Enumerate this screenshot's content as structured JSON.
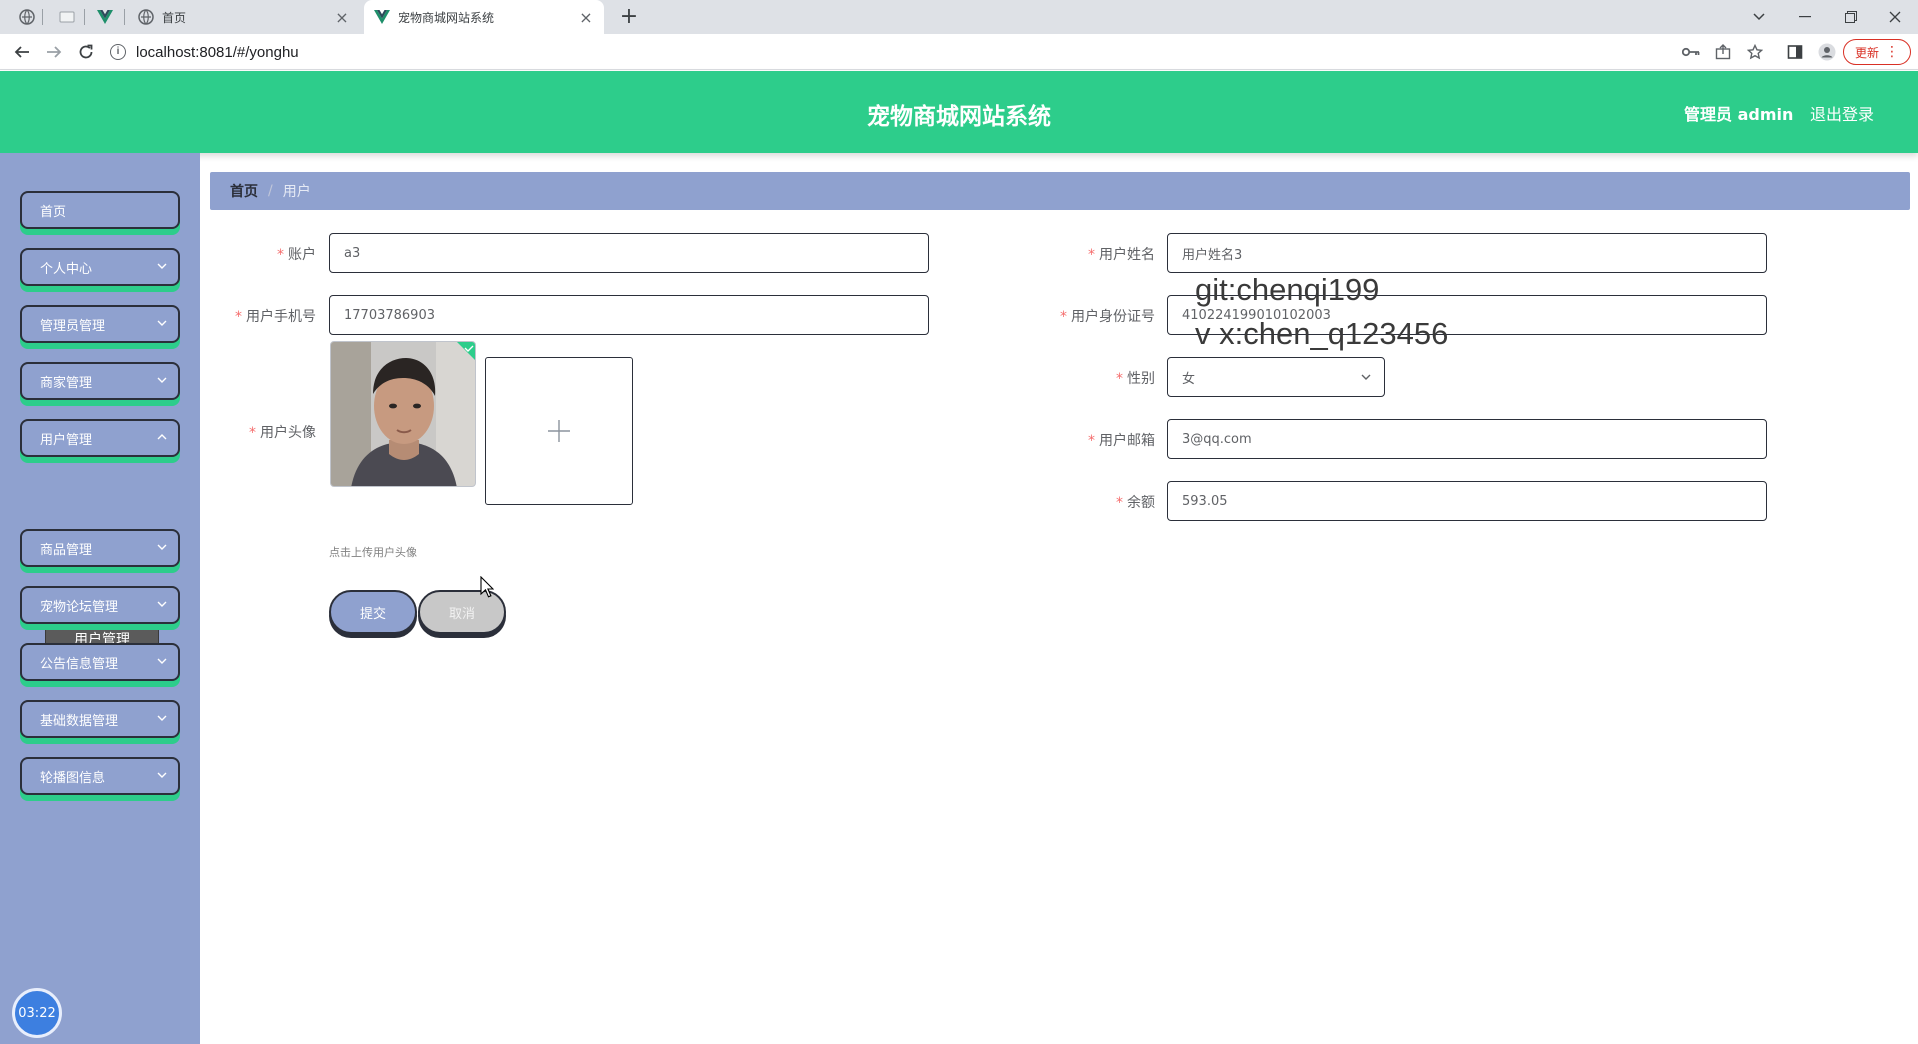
{
  "browser": {
    "tabs": [
      {
        "title": "首页"
      },
      {
        "title": "宠物商城网站系统"
      }
    ],
    "url": "localhost:8081/#/yonghu",
    "update_label": "更新"
  },
  "header": {
    "title": "宠物商城网站系统",
    "user": "管理员 admin",
    "logout": "退出登录"
  },
  "sidebar": {
    "items": [
      {
        "label": "首页"
      },
      {
        "label": "个人中心"
      },
      {
        "label": "管理员管理"
      },
      {
        "label": "商家管理"
      },
      {
        "label": "用户管理"
      },
      {
        "label": "商品管理"
      },
      {
        "label": "宠物论坛管理"
      },
      {
        "label": "公告信息管理"
      },
      {
        "label": "基础数据管理"
      },
      {
        "label": "轮播图信息"
      }
    ],
    "sub_item": "用户管理",
    "timer": "03:22"
  },
  "breadcrumb": {
    "home": "首页",
    "separator": "/",
    "current": "用户"
  },
  "form": {
    "account_label": "账户",
    "account_value": "a3",
    "name_label": "用户姓名",
    "name_value": "用户姓名3",
    "phone_label": "用户手机号",
    "phone_value": "17703786903",
    "idcard_label": "用户身份证号",
    "idcard_value": "410224199010102003",
    "avatar_label": "用户头像",
    "gender_label": "性别",
    "gender_value": "女",
    "email_label": "用户邮箱",
    "email_value": "3@qq.com",
    "balance_label": "余额",
    "balance_value": "593.05",
    "upload_hint": "点击上传用户头像",
    "required_mark": "*",
    "submit": "提交",
    "cancel": "取消"
  },
  "watermark": {
    "line1": "git:chenqi199",
    "line2": "v x:chen_q123456"
  },
  "colors": {
    "header_green": "#2dcd8b",
    "sidebar_blue": "#8fa1cf",
    "required_red": "#f56c6c"
  }
}
